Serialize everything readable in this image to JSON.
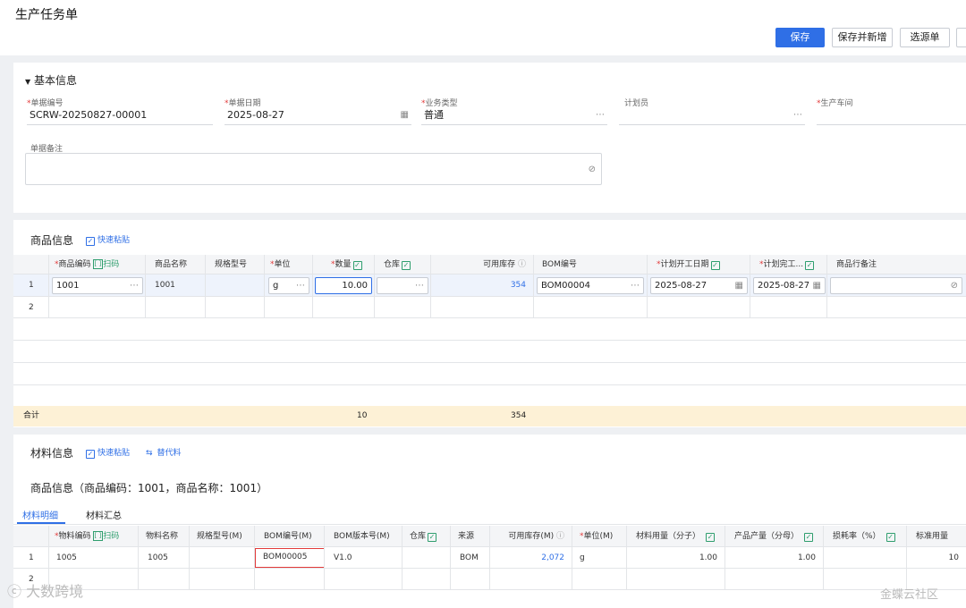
{
  "page": {
    "title": "生产任务单"
  },
  "toolbar": {
    "save": "保存",
    "save_new": "保存并新增",
    "select_source": "选源单"
  },
  "basic": {
    "section_title": "基本信息",
    "fields": [
      {
        "label": "单据编号",
        "value": "SCRW-20250827-00001",
        "required": true
      },
      {
        "label": "单据日期",
        "value": "2025-08-27",
        "required": true
      },
      {
        "label": "业务类型",
        "value": "普通",
        "required": true
      },
      {
        "label": "计划员",
        "value": "",
        "required": false
      },
      {
        "label": "生产车间",
        "value": "",
        "required": true
      }
    ],
    "remark_label": "单据备注"
  },
  "goods": {
    "section_title": "商品信息",
    "quick_paste": "快速粘贴",
    "scan_label": "扫码",
    "headers": [
      "商品编码",
      "商品名称",
      "规格型号",
      "单位",
      "数量",
      "仓库",
      "可用库存",
      "BOM编号",
      "计划开工日期",
      "计划完工...",
      "商品行备注"
    ],
    "rows": [
      {
        "no": "1",
        "code": "1001",
        "name": "1001",
        "spec": "",
        "unit": "g",
        "qty": "10.00",
        "warehouse": "",
        "stock": "354",
        "bom": "BOM00004",
        "start": "2025-08-27",
        "end": "2025-08-27",
        "remark": ""
      },
      {
        "no": "2"
      }
    ],
    "total": {
      "label": "合计",
      "qty": "10",
      "stock": "354"
    }
  },
  "materials": {
    "section_title": "材料信息",
    "quick_paste": "快速粘贴",
    "substitute": "替代料",
    "product_caption": "商品信息（商品编码：1001，商品名称：1001）",
    "tabs": [
      "材料明细",
      "材料汇总"
    ],
    "scan_label": "扫码",
    "headers": [
      "物料编码",
      "物料名称",
      "规格型号(M)",
      "BOM编号(M)",
      "BOM版本号(M)",
      "仓库",
      "来源",
      "可用库存(M)",
      "单位(M)",
      "材料用量（分子）",
      "产品产量（分母）",
      "损耗率（%）",
      "标准用量"
    ],
    "rows": [
      {
        "no": "1",
        "code": "1005",
        "name": "1005",
        "spec": "",
        "bom": "BOM00005",
        "bom_ver": "V1.0",
        "warehouse": "",
        "source": "BOM",
        "stock": "2,072",
        "unit": "g",
        "usage": "1.00",
        "output": "1.00",
        "loss": "",
        "std": "10"
      },
      {
        "no": "2"
      }
    ]
  },
  "watermarks": {
    "left": "大数跨境",
    "right": "金蝶云社区"
  },
  "colors": {
    "primary": "#2f6fe6",
    "total_row": "#fdf1d6",
    "highlight_border": "#e23b3b",
    "check_green": "#2f9e6e"
  }
}
